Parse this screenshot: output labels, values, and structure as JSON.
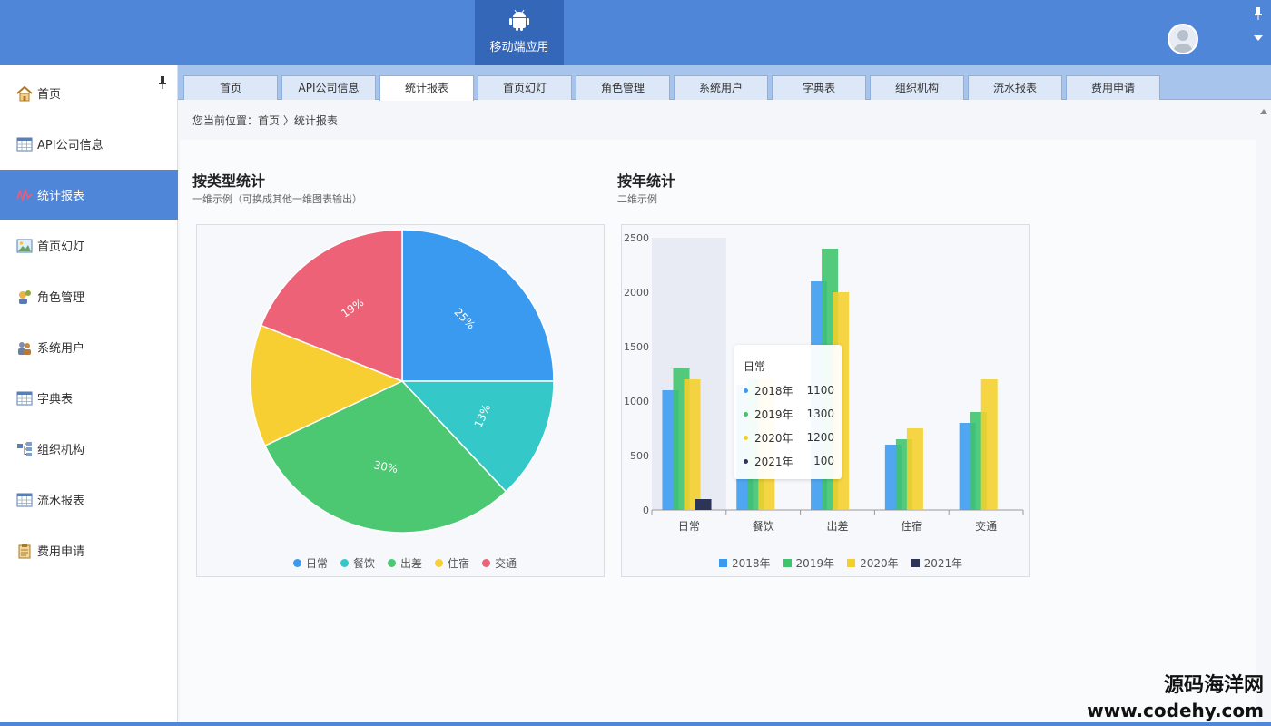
{
  "header": {
    "app_label": "移动端应用",
    "icons": [
      "android-icon",
      "user-avatar-icon",
      "pin-icon",
      "caret-down-icon"
    ]
  },
  "sidebar": {
    "items": [
      {
        "label": "首页",
        "icon": "home-icon",
        "active": false
      },
      {
        "label": "API公司信息",
        "icon": "table-icon",
        "active": false
      },
      {
        "label": "统计报表",
        "icon": "chart-line-icon",
        "active": true
      },
      {
        "label": "首页幻灯",
        "icon": "image-icon",
        "active": false
      },
      {
        "label": "角色管理",
        "icon": "role-icon",
        "active": false
      },
      {
        "label": "系统用户",
        "icon": "users-icon",
        "active": false
      },
      {
        "label": "字典表",
        "icon": "table-icon",
        "active": false
      },
      {
        "label": "组织机构",
        "icon": "org-icon",
        "active": false
      },
      {
        "label": "流水报表",
        "icon": "table-icon",
        "active": false
      },
      {
        "label": "费用申请",
        "icon": "clipboard-icon",
        "active": false
      }
    ]
  },
  "tabs": [
    "首页",
    "API公司信息",
    "统计报表",
    "首页幻灯",
    "角色管理",
    "系统用户",
    "字典表",
    "组织机构",
    "流水报表",
    "费用申请"
  ],
  "active_tab": "统计报表",
  "breadcrumb": "您当前位置：首页 〉统计报表",
  "pie_card": {
    "title": "按类型统计",
    "subtitle": "一维示例（可换成其他一维图表输出）"
  },
  "bar_card": {
    "title": "按年统计",
    "subtitle": "二维示例"
  },
  "tooltip": {
    "title": "日常",
    "rows": [
      {
        "name": "2018年",
        "value": "1100",
        "color": "#3a9af0"
      },
      {
        "name": "2019年",
        "value": "1300",
        "color": "#3ec46a"
      },
      {
        "name": "2020年",
        "value": "1200",
        "color": "#f5cf29"
      },
      {
        "name": "2021年",
        "value": "100",
        "color": "#2c3558"
      }
    ]
  },
  "watermark": {
    "line1": "源码海洋网",
    "line2": "www.codehy.com"
  },
  "chart_data": [
    {
      "type": "pie",
      "categories": [
        "日常",
        "餐饮",
        "出差",
        "住宿",
        "交通"
      ],
      "values": [
        25,
        13,
        30,
        13,
        19
      ],
      "labels": [
        "25%",
        "13%",
        "30%",
        "",
        "19%"
      ],
      "colors": [
        "#3a9af0",
        "#35c8c8",
        "#4cc772",
        "#f7cf33",
        "#ee6278"
      ],
      "legend_position": "bottom"
    },
    {
      "type": "bar",
      "categories": [
        "日常",
        "餐饮",
        "出差",
        "住宿",
        "交通"
      ],
      "series": [
        {
          "name": "2018年",
          "values": [
            1100,
            1150,
            2100,
            600,
            800
          ],
          "color": "#3a9af0"
        },
        {
          "name": "2019年",
          "values": [
            1300,
            1200,
            2400,
            650,
            900
          ],
          "color": "#3ec46a"
        },
        {
          "name": "2020年",
          "values": [
            1200,
            1200,
            2000,
            750,
            1200
          ],
          "color": "#f5cf29"
        },
        {
          "name": "2021年",
          "values": [
            100,
            0,
            0,
            0,
            0
          ],
          "color": "#2c3558"
        }
      ],
      "ylim": [
        0,
        2500
      ],
      "yticks": [
        "0",
        "500",
        "1000",
        "1500",
        "2000",
        "2500"
      ],
      "grid": false,
      "legend_position": "bottom",
      "highlighted_category": "日常"
    }
  ]
}
